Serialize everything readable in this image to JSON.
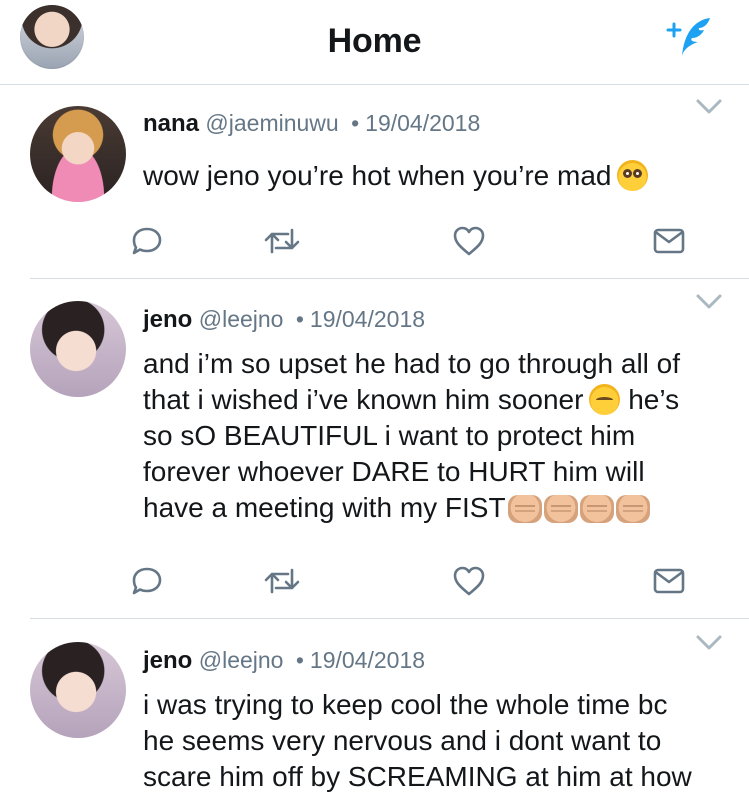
{
  "header": {
    "title": "Home",
    "left_icon": "profile-avatar",
    "right_icon": "compose-tweet-icon"
  },
  "colors": {
    "twitter_blue": "#1DA1F2",
    "text_primary": "#14171A",
    "text_secondary": "#657786",
    "separator": "#D7DDE2"
  },
  "tweets": [
    {
      "name": "nana",
      "handle": "@jaeminuwu",
      "dot": "•",
      "date": "19/04/2018",
      "avatar": "nana-avatar",
      "lines": [
        "wow jeno you’re hot when you’re mad"
      ],
      "trailing_emoji": [
        "flushed-face-emoji"
      ]
    },
    {
      "name": "jeno",
      "handle": "@leejno",
      "dot": "•",
      "date": "19/04/2018",
      "avatar": "jeno-avatar",
      "lines": [
        "and i’m so upset he had to go through all of",
        "that i wished i’ve known him sooner",
        "he’s",
        "so sO BEAUTIFUL i want to protect him",
        "forever whoever DARE to HURT him will",
        "have a meeting with my FIST"
      ],
      "trailing_emoji": [
        "pensive-face-emoji",
        "oncoming-fist-emoji",
        "oncoming-fist-emoji",
        "oncoming-fist-emoji",
        "oncoming-fist-emoji"
      ]
    },
    {
      "name": "jeno",
      "handle": "@leejno",
      "dot": "•",
      "date": "19/04/2018",
      "avatar": "jeno-avatar",
      "lines": [
        "i was trying to keep cool the whole time bc",
        "he seems very nervous and i dont want to",
        "scare him off by SCREAMING at him at how"
      ]
    }
  ],
  "actions": [
    "reply-icon",
    "retweet-icon",
    "like-icon",
    "direct-message-icon"
  ]
}
